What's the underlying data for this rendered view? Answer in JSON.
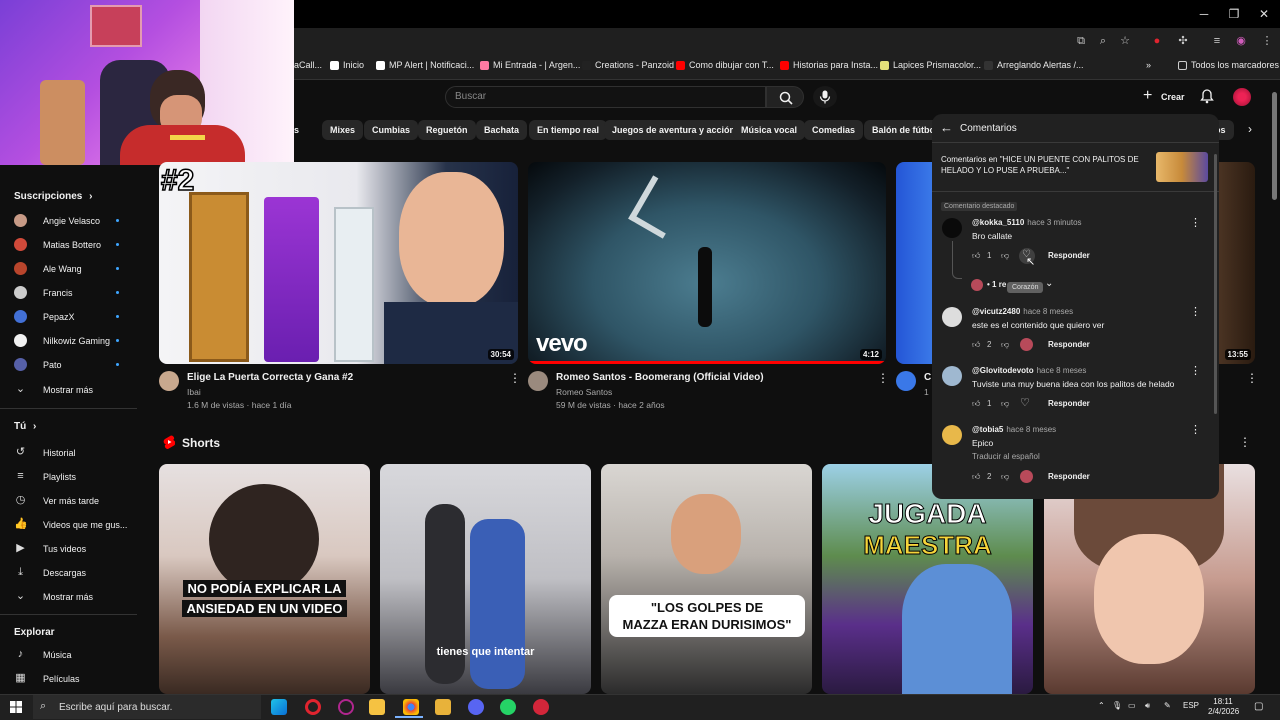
{
  "browser": {
    "bookmarks": [
      {
        "label": "aCall...",
        "icon": "bookmark-icon",
        "color": "#f1f1f1"
      },
      {
        "label": "Inicio",
        "icon": "x-logo-icon",
        "color": "#ffffff"
      },
      {
        "label": "MP Alert | Notificaci...",
        "icon": "mp-alert-icon",
        "color": "#ffffff"
      },
      {
        "label": "Mi Entrada - | Argen...",
        "icon": "ticket-icon",
        "color": "#ff7aa2"
      },
      {
        "label": "Creations - Panzoid",
        "icon": "panzoid-icon",
        "color": "#222222"
      },
      {
        "label": "Como dibujar con T...",
        "icon": "youtube-icon",
        "color": "#ff0000"
      },
      {
        "label": "Historias para Insta...",
        "icon": "youtube-icon",
        "color": "#ff0000"
      },
      {
        "label": "Lapices Prismacolor...",
        "icon": "pencil-icon",
        "color": "#e4e07a"
      },
      {
        "label": "Arreglando Alertas /...",
        "icon": "alert-icon",
        "color": "#333333"
      }
    ],
    "all_bookmarks": "Todos los marcadores"
  },
  "youtube": {
    "search_placeholder": "Buscar",
    "create_label": "Crear",
    "chips": [
      "gos",
      "Mixes",
      "Cumbias",
      "Reguetón",
      "Bachata",
      "En tiempo real",
      "Juegos de aventura y acción",
      "Música vocal",
      "Comedias",
      "Balón de fútbol",
      "tos"
    ],
    "sidebar": {
      "subs_title": "Suscripciones",
      "subscriptions": [
        {
          "name": "Angie Velasco",
          "color": "#c79a86"
        },
        {
          "name": "Matias Bottero",
          "color": "#d14a3a"
        },
        {
          "name": "Ale Wang",
          "color": "#b9452c"
        },
        {
          "name": "Francis",
          "color": "#cccccc"
        },
        {
          "name": "PepazX",
          "color": "#4270d6"
        },
        {
          "name": "Nilkowiz Gaming",
          "color": "#f1f1f1"
        },
        {
          "name": "Pato",
          "color": "#5660a8"
        }
      ],
      "show_more": "Mostrar más",
      "you_title": "Tú",
      "you_items": [
        {
          "label": "Historial",
          "icon": "history-icon",
          "glyph": "↺"
        },
        {
          "label": "Playlists",
          "icon": "playlist-icon",
          "glyph": "≡"
        },
        {
          "label": "Ver más tarde",
          "icon": "watch-later-icon",
          "glyph": "◷"
        },
        {
          "label": "Videos que me gus...",
          "icon": "like-icon",
          "glyph": "👍"
        },
        {
          "label": "Tus videos",
          "icon": "your-videos-icon",
          "glyph": "▶"
        },
        {
          "label": "Descargas",
          "icon": "download-icon",
          "glyph": "⤓"
        }
      ],
      "you_show_more": "Mostrar más",
      "explore_title": "Explorar",
      "explore_items": [
        {
          "label": "Música",
          "icon": "music-icon",
          "glyph": "♪"
        },
        {
          "label": "Películas",
          "icon": "movies-icon",
          "glyph": "▦"
        }
      ]
    },
    "videos": [
      {
        "title": "Elige La Puerta Correcta y Gana #2",
        "channel": "Ibai",
        "meta": "1.6 M de vistas · hace 1 día",
        "duration": "30:54",
        "badge": "#2"
      },
      {
        "title": "Romeo Santos - Boomerang (Official Video)",
        "channel": "Romeo Santos",
        "meta": "59 M de vistas · hace 2 años",
        "duration": "4:12",
        "brand": "vevo"
      },
      {
        "title": "C",
        "channel": "",
        "meta": "1",
        "duration": "13:55"
      }
    ],
    "shorts_title": "Shorts",
    "shorts": [
      {
        "caption_a": "NO PODÍA EXPLICAR LA",
        "caption_b": "ANSIEDAD EN UN VIDEO"
      },
      {
        "caption_a": "tienes que intentar"
      },
      {
        "caption_a": "\"LOS GOLPES DE",
        "caption_b": "MAZZA ERAN DURISIMOS\""
      },
      {
        "caption_a": "JUGADA",
        "caption_b": "MAESTRA"
      },
      {
        "caption_a": ""
      }
    ]
  },
  "comments": {
    "title": "Comentarios",
    "context": "Comentarios en \"HICE UN PUENTE CON PALITOS DE HELADO Y LO PUSE A PRUEBA...\"",
    "context_line1": "Comentarios en \"HICE UN PUENTE CON PALITOS DE",
    "context_line2": "HELADO Y LO PUSE A PRUEBA...\"",
    "pinned_label": "Comentario destacado",
    "reply_label": "Responder",
    "tooltip": "Corazón",
    "replies_label": "1 re",
    "translate_label": "Traducir al español",
    "items": [
      {
        "user": "@kokka_5110",
        "time": "hace 3 minutos",
        "text": "Bro callate",
        "likes": "1",
        "avatar": "#111111"
      },
      {
        "user": "@vicutz2480",
        "time": "hace 8 meses",
        "text": "este es el contenido que quiero ver",
        "likes": "2",
        "avatar": "#dddddd"
      },
      {
        "user": "@Glovitodevoto",
        "time": "hace 8 meses",
        "text": "Tuviste una muy buena idea con los palitos de helado",
        "likes": "1",
        "avatar": "#9fb8d0"
      },
      {
        "user": "@tobia5",
        "time": "hace 8 meses",
        "text": "Epico",
        "likes": "2",
        "avatar": "#e8b84a"
      }
    ]
  },
  "taskbar": {
    "search_placeholder": "Escribe aquí para buscar.",
    "lang": "ESP",
    "time": "18:11",
    "date": "2/4/2026"
  }
}
